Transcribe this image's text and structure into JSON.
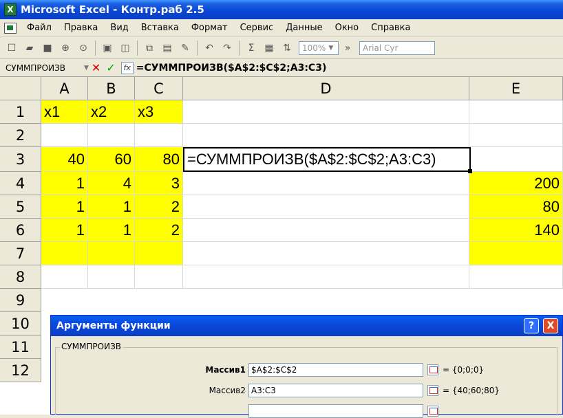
{
  "window": {
    "title": "Microsoft Excel - Контр.раб 2.5",
    "logo_text": "X"
  },
  "menu": [
    "Файл",
    "Правка",
    "Вид",
    "Вставка",
    "Формат",
    "Сервис",
    "Данные",
    "Окно",
    "Справка"
  ],
  "toolbar": {
    "zoom": "100%",
    "font": "Arial Cyr"
  },
  "formula_bar": {
    "name_box": "СУММПРОИЗВ",
    "formula": "=СУММПРОИЗВ($A$2:$C$2;A3:C3)",
    "fx_label": "fx"
  },
  "columns": [
    "A",
    "B",
    "C",
    "D",
    "E"
  ],
  "rows": [
    "1",
    "2",
    "3",
    "4",
    "5",
    "6",
    "7",
    "8",
    "9",
    "10",
    "11",
    "12"
  ],
  "cells": {
    "A1": "x1",
    "B1": "x2",
    "C1": "x3",
    "A3": "40",
    "B3": "60",
    "C3": "80",
    "D3": "=СУММПРОИЗВ($A$2:$C$2;A3:C3)",
    "A4": "1",
    "B4": "4",
    "C4": "3",
    "E4": "200",
    "A5": "1",
    "B5": "1",
    "C5": "2",
    "E5": "80",
    "A6": "1",
    "B6": "1",
    "C6": "2",
    "E6": "140"
  },
  "dialog": {
    "title": "Аргументы функции",
    "help": "?",
    "close": "X",
    "group": "СУММПРОИЗВ",
    "args": [
      {
        "label": "Массив1",
        "value": "$A$2:$C$2",
        "result": "= {0;0;0}"
      },
      {
        "label": "Массив2",
        "value": "A3:C3",
        "result": "= {40;60;80}"
      },
      {
        "label": "",
        "value": "",
        "result": ""
      }
    ]
  },
  "colors": {
    "highlight": "#ffff00",
    "title_blue": "#0a47d9"
  }
}
